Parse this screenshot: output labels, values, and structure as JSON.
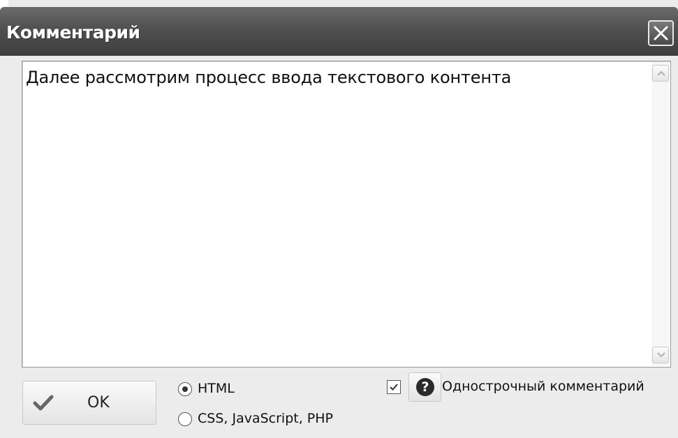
{
  "window": {
    "title": "Комментарий"
  },
  "comment": {
    "text": "Далее рассмотрим процесс ввода текстового контента"
  },
  "buttons": {
    "ok_label": "OK"
  },
  "syntax_options": [
    {
      "label": "HTML",
      "selected": true
    },
    {
      "label": "CSS, JavaScript, PHP",
      "selected": false
    }
  ],
  "single_line": {
    "label": "Однострочный комментарий",
    "checked": true
  },
  "icons": {
    "close": "close-icon",
    "ok": "checkmark-icon",
    "help": "question-icon",
    "scroll_up": "chevron-up-icon",
    "scroll_down": "chevron-down-icon"
  },
  "colors": {
    "titlebar": "#505050",
    "window_bg": "#ececec"
  }
}
